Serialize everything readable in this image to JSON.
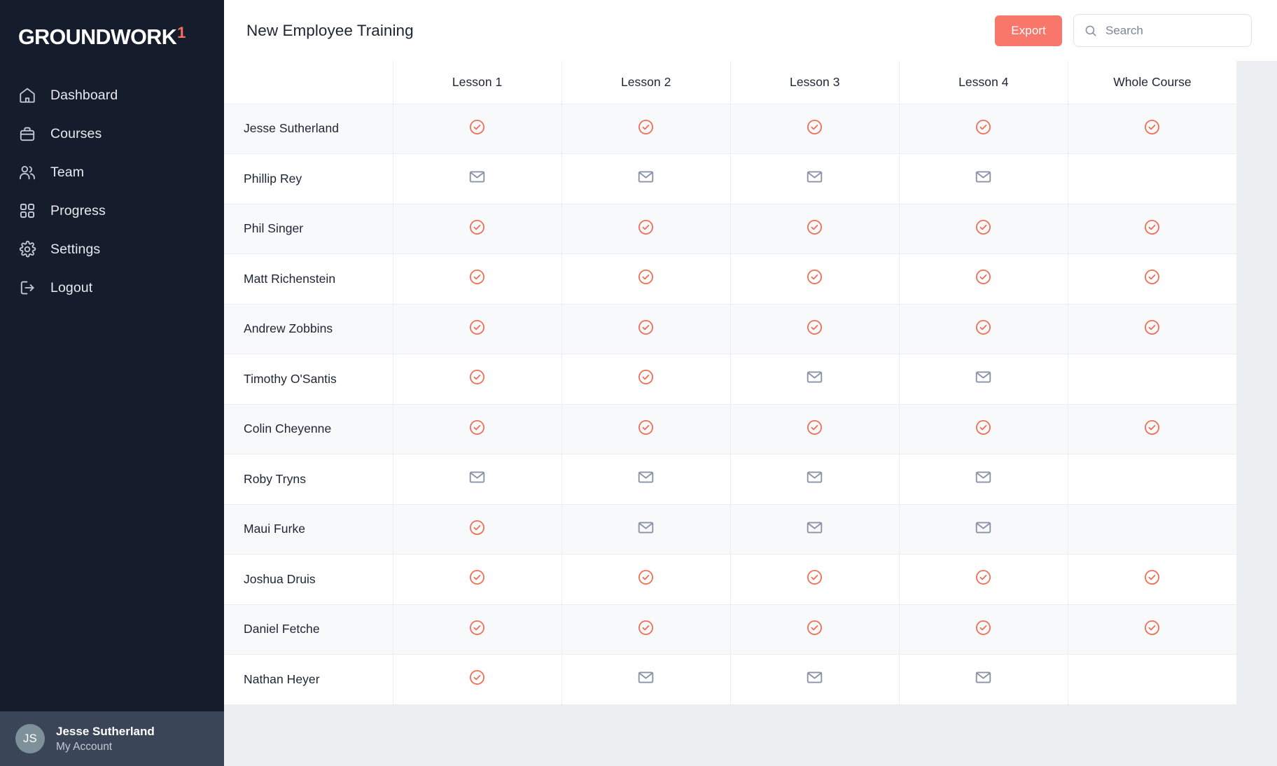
{
  "brand": {
    "name": "GROUNDWORK",
    "mark": "1",
    "accent": "#F4705A"
  },
  "sidebar": {
    "background": "#151C2C",
    "items": [
      {
        "label": "Dashboard",
        "icon": "home-icon"
      },
      {
        "label": "Courses",
        "icon": "briefcase-icon"
      },
      {
        "label": "Team",
        "icon": "users-icon"
      },
      {
        "label": "Progress",
        "icon": "grid-icon"
      },
      {
        "label": "Settings",
        "icon": "gear-icon"
      },
      {
        "label": "Logout",
        "icon": "logout-icon"
      }
    ],
    "user": {
      "initials": "JS",
      "name": "Jesse Sutherland",
      "subtitle": "My Account"
    }
  },
  "header": {
    "title": "New Employee Training",
    "export_label": "Export",
    "export_color": "#F8776A",
    "search": {
      "placeholder": "Search",
      "value": "",
      "icon": "search-icon"
    }
  },
  "table": {
    "columns": [
      "",
      "Lesson 1",
      "Lesson 2",
      "Lesson 3",
      "Lesson 4",
      "Whole Course"
    ],
    "status_icons": {
      "complete": "check-circle-icon",
      "invited": "envelope-icon",
      "none": "empty"
    },
    "complete_color": "#F26B52",
    "invited_color": "#8A93A5",
    "rows": [
      {
        "name": "Jesse Sutherland",
        "statuses": [
          "complete",
          "complete",
          "complete",
          "complete",
          "complete"
        ]
      },
      {
        "name": "Phillip Rey",
        "statuses": [
          "invited",
          "invited",
          "invited",
          "invited",
          "none"
        ]
      },
      {
        "name": "Phil Singer",
        "statuses": [
          "complete",
          "complete",
          "complete",
          "complete",
          "complete"
        ]
      },
      {
        "name": "Matt Richenstein",
        "statuses": [
          "complete",
          "complete",
          "complete",
          "complete",
          "complete"
        ]
      },
      {
        "name": "Andrew Zobbins",
        "statuses": [
          "complete",
          "complete",
          "complete",
          "complete",
          "complete"
        ]
      },
      {
        "name": "Timothy O'Santis",
        "statuses": [
          "complete",
          "complete",
          "invited",
          "invited",
          "none"
        ]
      },
      {
        "name": "Colin Cheyenne",
        "statuses": [
          "complete",
          "complete",
          "complete",
          "complete",
          "complete"
        ]
      },
      {
        "name": "Roby Tryns",
        "statuses": [
          "invited",
          "invited",
          "invited",
          "invited",
          "none"
        ]
      },
      {
        "name": "Maui Furke",
        "statuses": [
          "complete",
          "invited",
          "invited",
          "invited",
          "none"
        ]
      },
      {
        "name": "Joshua Druis",
        "statuses": [
          "complete",
          "complete",
          "complete",
          "complete",
          "complete"
        ]
      },
      {
        "name": "Daniel Fetche",
        "statuses": [
          "complete",
          "complete",
          "complete",
          "complete",
          "complete"
        ]
      },
      {
        "name": "Nathan Heyer",
        "statuses": [
          "complete",
          "invited",
          "invited",
          "invited",
          "none"
        ]
      }
    ]
  }
}
